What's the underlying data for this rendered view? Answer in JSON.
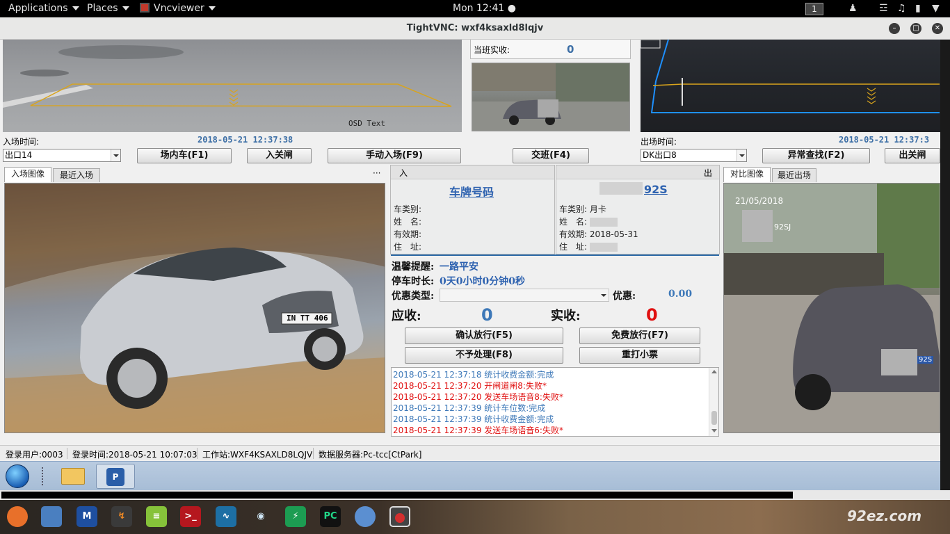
{
  "topbar": {
    "applications": "Applications",
    "places": "Places",
    "active_app": "Vncviewer",
    "clock": "Mon 12:41 ●",
    "workspace": "1"
  },
  "vnc": {
    "title": "TightVNC: wxf4ksaxld8lqjv"
  },
  "entry": {
    "camera_overlay": "OSD  Text",
    "time_label": "入场时间:",
    "time_value": "2018-05-21 12:37:38",
    "gate_select": "出口14",
    "btn_in_lot": "场内车(F1)",
    "btn_close_gate": "入关闸",
    "btn_manual_entry": "手动入场(F9)",
    "tab_image": "入场图像",
    "tab_recent": "最近入场",
    "more": "···"
  },
  "shift": {
    "label": "当班实收:",
    "value": "0",
    "btn_handover": "交班(F4)"
  },
  "exit": {
    "time_label": "出场时间:",
    "time_value": "2018-05-21 12:37:3",
    "gate_select": "DK出口8",
    "btn_abnormal": "异常查找(F2)",
    "btn_close_gate": "出关闸",
    "tab_compare": "对比图像",
    "tab_recent": "最近出场",
    "photo_date": "21/05/2018",
    "photo_plate": "92SJ",
    "plate_tag": "92S"
  },
  "info_in": {
    "header": "入",
    "plate": "车牌号码",
    "car_type_label": "车类别:",
    "name_label": "姓　名:",
    "valid_label": "有效期:",
    "address_label": "住　址:"
  },
  "info_out": {
    "header": "出",
    "plate": "92S",
    "car_type_label": "车类别:",
    "car_type": "月卡",
    "name_label": "姓　名:",
    "valid_label": "有效期:",
    "valid": "2018-05-31",
    "address_label": "住　址:"
  },
  "charge": {
    "reminder_label": "温馨提醒:",
    "reminder_value": "一路平安",
    "duration_label": "停车时长:",
    "duration_value": "0天0小时0分钟0秒",
    "discount_type_label": "优惠类型:",
    "discount_label": "优惠:",
    "discount_value": "0.00",
    "receivable_label": "应收:",
    "receivable_value": "0",
    "received_label": "实收:",
    "received_value": "0",
    "btn_confirm": "确认放行(F5)",
    "btn_free": "免费放行(F7)",
    "btn_ignore": "不予处理(F8)",
    "btn_reprint": "重打小票"
  },
  "log": [
    {
      "text": "2018-05-21 12:37:18 统计收费金额:完成",
      "color": "#3d78b8"
    },
    {
      "text": "2018-05-21 12:37:20 开闸道闸8:失败*",
      "color": "#e01010"
    },
    {
      "text": "2018-05-21 12:37:20 发送车场语音8:失败*",
      "color": "#e01010"
    },
    {
      "text": "2018-05-21 12:37:39 统计车位数:完成",
      "color": "#3d78b8"
    },
    {
      "text": "2018-05-21 12:37:39 统计收费金额:完成",
      "color": "#3d78b8"
    },
    {
      "text": "2018-05-21 12:37:39 发送车场语音6:失败*",
      "color": "#e01010"
    }
  ],
  "status": {
    "user": "登录用户:0003",
    "login_time": "登录时间:2018-05-21 10:07:03",
    "workstation": "工作站:WXF4KSAXLD8LQJV",
    "server": "数据服务器:Pc-tcc[CtPark]"
  },
  "entry_photo_plate": "IN TT 406",
  "watermark": "92ez.com",
  "colors": {
    "accent_blue": "#2f63b0",
    "alert_red": "#e01010"
  }
}
